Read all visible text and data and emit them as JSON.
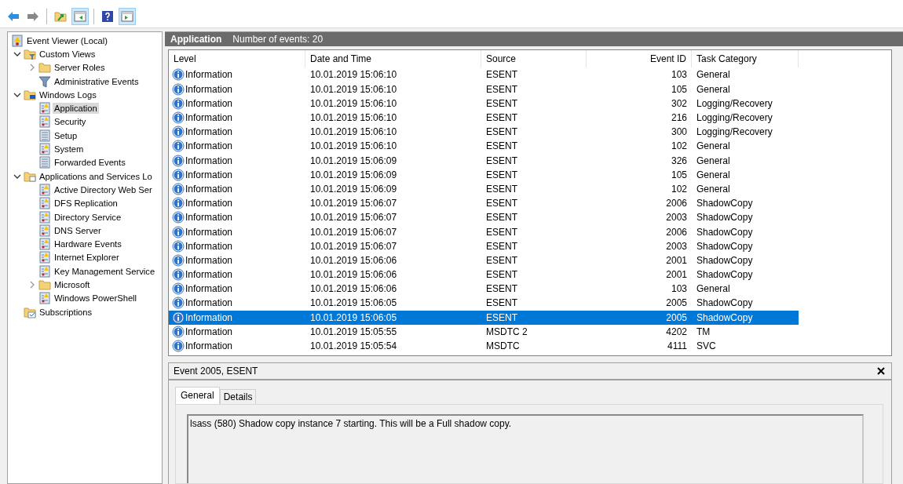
{
  "toolbar": [
    {
      "buttons": [
        {
          "kind": "back",
          "pressed": false
        },
        {
          "kind": "forward",
          "pressed": false
        }
      ]
    },
    {
      "buttons": [
        {
          "kind": "up",
          "pressed": false
        },
        {
          "kind": "tree-pane",
          "pressed": true
        }
      ]
    },
    {
      "buttons": [
        {
          "kind": "help",
          "pressed": false
        },
        {
          "kind": "action-pane",
          "pressed": true
        }
      ]
    }
  ],
  "tree": [
    {
      "label": "Event Viewer (Local)",
      "kind": "root",
      "selected": false,
      "children": [
        {
          "label": "Custom Views",
          "kind": "filter-folder",
          "expanded": true,
          "selected": false,
          "children": [
            {
              "label": "Server Roles",
              "kind": "folder",
              "expanded": false,
              "selected": false
            },
            {
              "label": "Administrative Events",
              "kind": "filter",
              "selected": false
            }
          ]
        },
        {
          "label": "Windows Logs",
          "kind": "pc-folder",
          "expanded": true,
          "selected": false,
          "children": [
            {
              "label": "Application",
              "kind": "log",
              "selected": true
            },
            {
              "label": "Security",
              "kind": "log",
              "selected": false
            },
            {
              "label": "Setup",
              "kind": "plain-log",
              "selected": false
            },
            {
              "label": "System",
              "kind": "log",
              "selected": false
            },
            {
              "label": "Forwarded Events",
              "kind": "plain-log",
              "selected": false
            }
          ]
        },
        {
          "label": "Applications and Services Lo",
          "kind": "app-folder",
          "expanded": true,
          "selected": false,
          "children": [
            {
              "label": "Active Directory Web Ser",
              "kind": "log",
              "selected": false
            },
            {
              "label": "DFS Replication",
              "kind": "log",
              "selected": false
            },
            {
              "label": "Directory Service",
              "kind": "log",
              "selected": false
            },
            {
              "label": "DNS Server",
              "kind": "log",
              "selected": false
            },
            {
              "label": "Hardware Events",
              "kind": "log",
              "selected": false
            },
            {
              "label": "Internet Explorer",
              "kind": "log",
              "selected": false
            },
            {
              "label": "Key Management Service",
              "kind": "log",
              "selected": false
            },
            {
              "label": "Microsoft",
              "kind": "folder",
              "expanded": false,
              "selected": false
            },
            {
              "label": "Windows PowerShell",
              "kind": "log",
              "selected": false
            }
          ]
        },
        {
          "label": "Subscriptions",
          "kind": "subscriptions",
          "selected": false
        }
      ]
    }
  ],
  "header": {
    "title": "Application",
    "count": "Number of events: 20"
  },
  "table": {
    "columns": [
      "Level",
      "Date and Time",
      "Source",
      "Event ID",
      "Task Category"
    ],
    "rows": [
      {
        "level": "Information",
        "date": "10.01.2019 15:06:10",
        "source": "ESENT",
        "event_id": "103",
        "category": "General",
        "selected": false
      },
      {
        "level": "Information",
        "date": "10.01.2019 15:06:10",
        "source": "ESENT",
        "event_id": "105",
        "category": "General",
        "selected": false
      },
      {
        "level": "Information",
        "date": "10.01.2019 15:06:10",
        "source": "ESENT",
        "event_id": "302",
        "category": "Logging/Recovery",
        "selected": false
      },
      {
        "level": "Information",
        "date": "10.01.2019 15:06:10",
        "source": "ESENT",
        "event_id": "216",
        "category": "Logging/Recovery",
        "selected": false
      },
      {
        "level": "Information",
        "date": "10.01.2019 15:06:10",
        "source": "ESENT",
        "event_id": "300",
        "category": "Logging/Recovery",
        "selected": false
      },
      {
        "level": "Information",
        "date": "10.01.2019 15:06:10",
        "source": "ESENT",
        "event_id": "102",
        "category": "General",
        "selected": false
      },
      {
        "level": "Information",
        "date": "10.01.2019 15:06:09",
        "source": "ESENT",
        "event_id": "326",
        "category": "General",
        "selected": false
      },
      {
        "level": "Information",
        "date": "10.01.2019 15:06:09",
        "source": "ESENT",
        "event_id": "105",
        "category": "General",
        "selected": false
      },
      {
        "level": "Information",
        "date": "10.01.2019 15:06:09",
        "source": "ESENT",
        "event_id": "102",
        "category": "General",
        "selected": false
      },
      {
        "level": "Information",
        "date": "10.01.2019 15:06:07",
        "source": "ESENT",
        "event_id": "2006",
        "category": "ShadowCopy",
        "selected": false
      },
      {
        "level": "Information",
        "date": "10.01.2019 15:06:07",
        "source": "ESENT",
        "event_id": "2003",
        "category": "ShadowCopy",
        "selected": false
      },
      {
        "level": "Information",
        "date": "10.01.2019 15:06:07",
        "source": "ESENT",
        "event_id": "2006",
        "category": "ShadowCopy",
        "selected": false
      },
      {
        "level": "Information",
        "date": "10.01.2019 15:06:07",
        "source": "ESENT",
        "event_id": "2003",
        "category": "ShadowCopy",
        "selected": false
      },
      {
        "level": "Information",
        "date": "10.01.2019 15:06:06",
        "source": "ESENT",
        "event_id": "2001",
        "category": "ShadowCopy",
        "selected": false
      },
      {
        "level": "Information",
        "date": "10.01.2019 15:06:06",
        "source": "ESENT",
        "event_id": "2001",
        "category": "ShadowCopy",
        "selected": false
      },
      {
        "level": "Information",
        "date": "10.01.2019 15:06:06",
        "source": "ESENT",
        "event_id": "103",
        "category": "General",
        "selected": false
      },
      {
        "level": "Information",
        "date": "10.01.2019 15:06:05",
        "source": "ESENT",
        "event_id": "2005",
        "category": "ShadowCopy",
        "selected": false
      },
      {
        "level": "Information",
        "date": "10.01.2019 15:06:05",
        "source": "ESENT",
        "event_id": "2005",
        "category": "ShadowCopy",
        "selected": true
      },
      {
        "level": "Information",
        "date": "10.01.2019 15:05:55",
        "source": "MSDTC 2",
        "event_id": "4202",
        "category": "TM",
        "selected": false
      },
      {
        "level": "Information",
        "date": "10.01.2019 15:05:54",
        "source": "MSDTC",
        "event_id": "4111",
        "category": "SVC",
        "selected": false
      }
    ]
  },
  "details": {
    "title": "Event 2005, ESENT",
    "tabs": [
      {
        "label": "General",
        "selected": true
      },
      {
        "label": "Details",
        "selected": false
      }
    ],
    "message": "lsass (580) Shadow copy instance 7 starting. This will be a Full shadow copy."
  }
}
